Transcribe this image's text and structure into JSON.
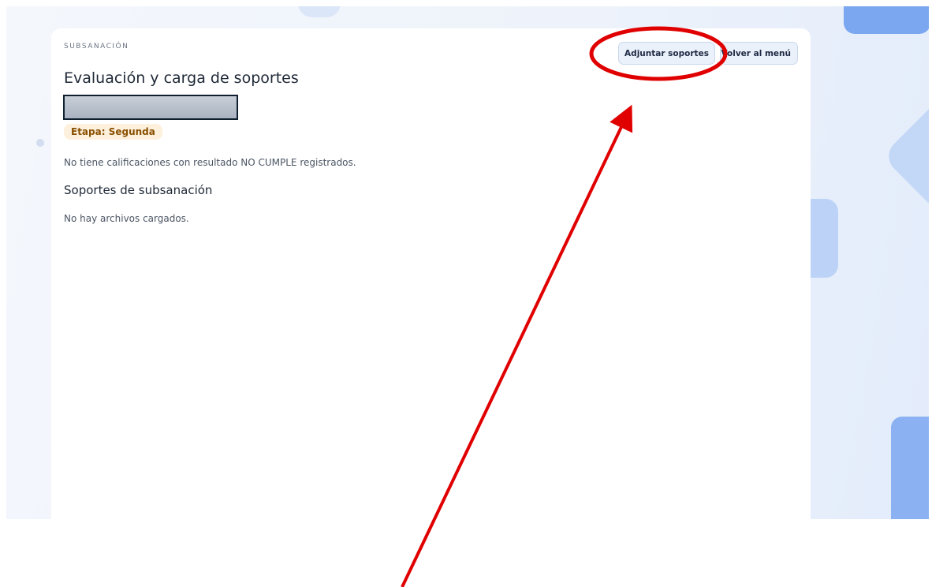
{
  "page": {
    "eyebrow": "SUBSANACIÓN",
    "title": "Evaluación y carga de soportes",
    "stage_badge": "Etapa: Segunda",
    "no_results_message": "No tiene calificaciones con resultado NO CUMPLE registrados.",
    "supports_heading": "Soportes de subsanación",
    "no_files_message": "No hay archivos cargados."
  },
  "actions": {
    "attach_label": "Adjuntar soportes",
    "back_label": "Volver al menú"
  },
  "colors": {
    "annotation": "#e00000",
    "badge_bg": "#fdf1dd",
    "badge_text": "#8a4f00",
    "button_bg": "#eaf1fb"
  }
}
